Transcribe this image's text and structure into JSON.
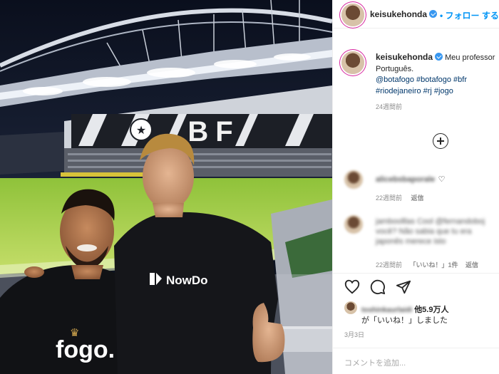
{
  "photo": {
    "shirt_left_text": "fogo.",
    "shirt_right_text": "NowDo",
    "banner_letters": "BF"
  },
  "header": {
    "username": "keisukehonda",
    "follow_label": "• フォロー する"
  },
  "caption": {
    "username": "keisukehonda",
    "text_line1": "Meu professor",
    "text_line2": "Português.",
    "tags_line1": "@botafogo #botafogo #bfr",
    "tags_line2": "#riodejaneiro #rj #jogo",
    "time": "24週間前"
  },
  "comments": [
    {
      "user": "alicebsbaporale",
      "heart": "♡",
      "time": "22週間前",
      "reply": "返信"
    },
    {
      "text1": "jamboolllas Cool @fernandoboj",
      "text2": "você? Não sabia que tu era",
      "text3": "japonês merece isto",
      "time": "22週間前",
      "likes": "「いいね！」1件",
      "reply": "返信"
    }
  ],
  "actions": {
    "like_icon": "heart-icon",
    "comment_icon": "comment-icon",
    "share_icon": "share-icon",
    "save_icon": "bookmark-icon"
  },
  "likes": {
    "liker": "toshinkaurlaidi",
    "count_text": "他5.9万人",
    "suffix": "が「いいね！」しました",
    "date": "3月3日"
  },
  "comment_input": {
    "placeholder": "コメントを追加..."
  },
  "colors": {
    "link": "#00376b",
    "follow": "#0095f6",
    "verified": "#3897f0",
    "meta": "#8e8e8e"
  }
}
